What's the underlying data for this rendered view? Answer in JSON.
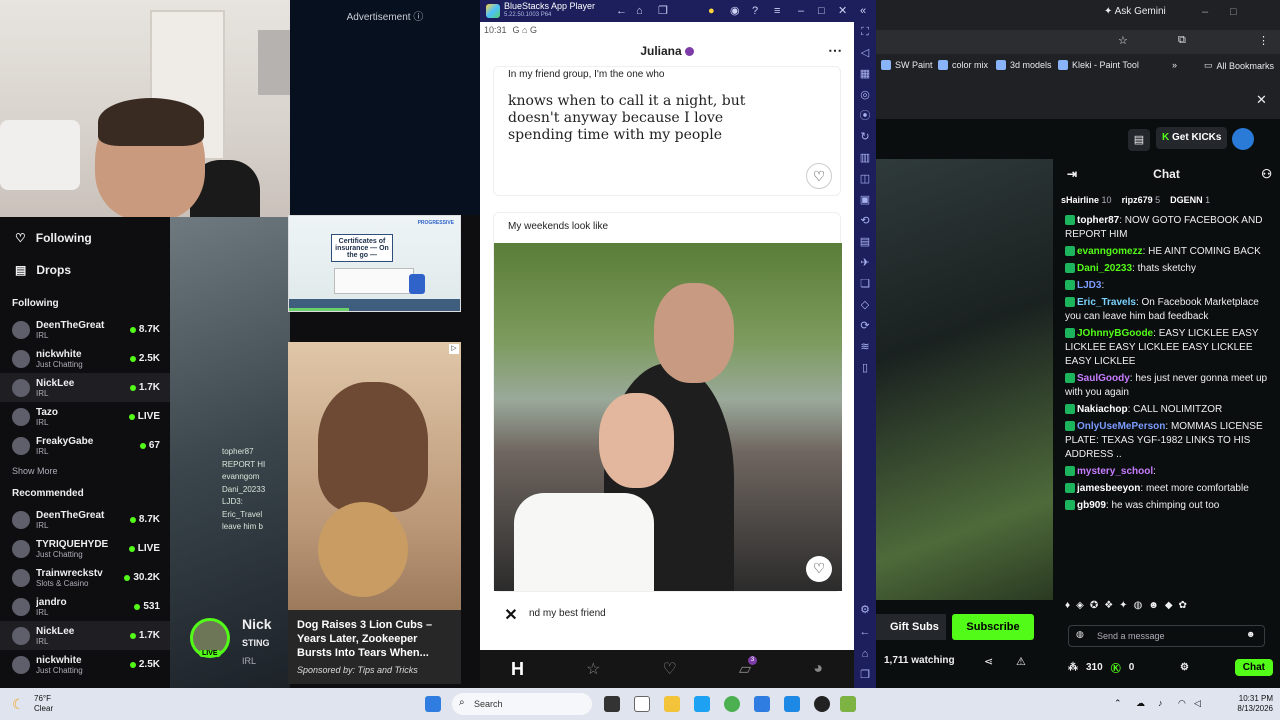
{
  "left_stream": {
    "ad_label": "Advertisement ⓘ",
    "nav": [
      {
        "label": "Following",
        "icon": "heart-icon"
      },
      {
        "label": "Drops",
        "icon": "drops-icon"
      }
    ],
    "following_header": "Following",
    "following": [
      {
        "name": "DeenTheGreat",
        "cat": "IRL",
        "viewers": "8.7K"
      },
      {
        "name": "nickwhite",
        "cat": "Just Chatting",
        "viewers": "2.5K"
      },
      {
        "name": "NickLee",
        "cat": "IRL",
        "viewers": "1.7K"
      },
      {
        "name": "Tazo",
        "cat": "IRL",
        "viewers": "LIVE"
      },
      {
        "name": "FreakyGabe",
        "cat": "IRL",
        "viewers": "67"
      }
    ],
    "show_more": "Show More",
    "recommended_header": "Recommended",
    "recommended": [
      {
        "name": "DeenTheGreat",
        "cat": "IRL",
        "viewers": "8.7K"
      },
      {
        "name": "TYRIQUEHYDE",
        "cat": "Just Chatting",
        "viewers": "LIVE"
      },
      {
        "name": "Trainwreckstv",
        "cat": "Slots & Casino",
        "viewers": "30.2K"
      },
      {
        "name": "jandro",
        "cat": "IRL",
        "viewers": "531"
      },
      {
        "name": "NickLee",
        "cat": "IRL",
        "viewers": "1.7K"
      },
      {
        "name": "nickwhite",
        "cat": "Just Chatting",
        "viewers": "2.5K"
      }
    ],
    "ghost_chat": "topher87\nREPORT HI\nevanngom\nDani_20233\nLJD3:\nEric_Travel\nleave him b",
    "streamer": {
      "name": "Nick",
      "sub1": "STING",
      "sub2": "IRL",
      "live": "LIVE"
    }
  },
  "ads": {
    "ad1_sign": "Certificates of insurance — On the go —",
    "ad2_title": "Dog Raises 3 Lion Cubs – Years Later, Zookeeper Bursts Into Tears When...",
    "ad2_sponsor": "Sponsored by: Tips and Tricks",
    "ad2_badge": "▷"
  },
  "bluestacks": {
    "title": "BlueStacks App Player",
    "version": "5.22.50.1003 P64",
    "time": "10:31",
    "status_icons": "G ⌂ G",
    "profile_name": "Juliana",
    "prompt1_q": "In my friend group, I'm the one who",
    "prompt1_a": "knows when to call it a night, but doesn't anyway because I love spending time with my people",
    "photo_q": "My weekends look like",
    "prompt2_q": "nd my best friend",
    "nav_badge": "3"
  },
  "browser": {
    "ask_gemini": "Ask Gemini",
    "bookmarks": [
      "SW Paint",
      "color mix",
      "3d models",
      "Kleki - Paint Tool"
    ],
    "all_bookmarks": "All Bookmarks",
    "get_kicks": "Get KICKs"
  },
  "chat": {
    "title": "Chat",
    "gifters": [
      {
        "name": "sHairline",
        "n": "10"
      },
      {
        "name": "ripz679",
        "n": "5"
      },
      {
        "name": "DGENN",
        "n": "1"
      }
    ],
    "messages": [
      {
        "user": "topher87",
        "text": "NOW GOTO FACEBOOK AND REPORT HIM",
        "color": "#ffffff"
      },
      {
        "user": "evanngomezz",
        "text": "HE AINT COMING BACK",
        "color": "#53fc18"
      },
      {
        "user": "Dani_20233",
        "text": "thats sketchy",
        "color": "#53fc18"
      },
      {
        "user": "LJD3",
        "text": "",
        "color": "#7b9cff"
      },
      {
        "user": "Eric_Travels",
        "text": "On Facebook Marketplace you can leave him bad feedback",
        "color": "#7bd3ff"
      },
      {
        "user": "JOhnnyBGoode",
        "text": "EASY LICKLEE EASY LICKLEE EASY LICKLEE EASY LICKLEE EASY LICKLEE",
        "color": "#53fc18"
      },
      {
        "user": "SaulGoody",
        "text": "hes just never gonna meet up with you again",
        "color": "#c77dff"
      },
      {
        "user": "Nakiachop",
        "text": "CALL NOLIMITZOR",
        "color": "#ffffff"
      },
      {
        "user": "OnlyUseMePerson",
        "text": "MOMMAS LICENSE PLATE: TEXAS YGF-1982 LINKS TO HIS ADDRESS ..",
        "color": "#7b9cff"
      },
      {
        "user": "mystery_school",
        "text": "",
        "color": "#c77dff"
      },
      {
        "user": "jamesbeeyon",
        "text": "meet more comfortable",
        "color": "#ffffff"
      },
      {
        "user": "gb909",
        "text": "he was chimping out too",
        "color": "#ffffff"
      }
    ],
    "send_placeholder": "Send a message",
    "points": "310",
    "coins": "0",
    "chat_btn": "Chat"
  },
  "stream_actions": {
    "gift_subs": "Gift Subs",
    "subscribe": "Subscribe",
    "watching": "1,711 watching"
  },
  "taskbar": {
    "temp": "76°F",
    "condition": "Clear",
    "search": "Search",
    "time": "10:31 PM",
    "date": "8/13/2026"
  }
}
